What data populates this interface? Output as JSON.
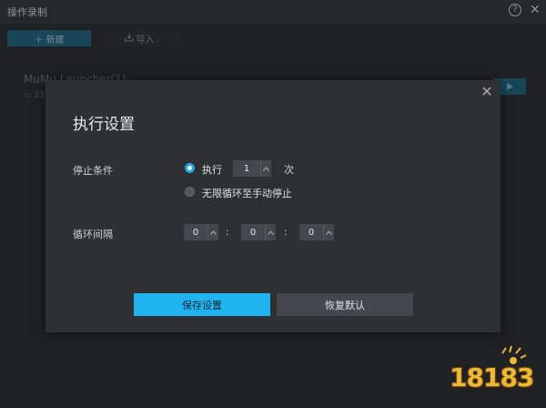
{
  "window": {
    "title": "操作录制",
    "help_icon": "question-circle-icon",
    "close_icon": "close-icon"
  },
  "toolbar": {
    "new_label": "新建",
    "new_icon": "plus-icon",
    "import_label": "导入",
    "import_icon": "import-icon"
  },
  "list": {
    "item_title": "MuMu Launcher(1)",
    "item_meta": "23",
    "run_icon": "play-icon"
  },
  "dialog": {
    "title": "执行设置",
    "close_icon": "close-icon",
    "stop_condition_label": "停止条件",
    "option_execute_label": "执行",
    "option_execute_selected": true,
    "execute_count": "1",
    "execute_unit": "次",
    "option_loop_label": "无限循环至手动停止",
    "option_loop_selected": false,
    "interval_label": "循环间隔",
    "interval_hours": "0",
    "interval_minutes": "0",
    "interval_seconds": "0",
    "colon": ":",
    "save_label": "保存设置",
    "reset_label": "恢复默认"
  },
  "watermark": {
    "text": "18183"
  },
  "colors": {
    "accent": "#1fb4f0",
    "radio_selected": "#1fa6e3",
    "dialog_bg": "#2e3034",
    "page_bg": "#2a2c30"
  }
}
